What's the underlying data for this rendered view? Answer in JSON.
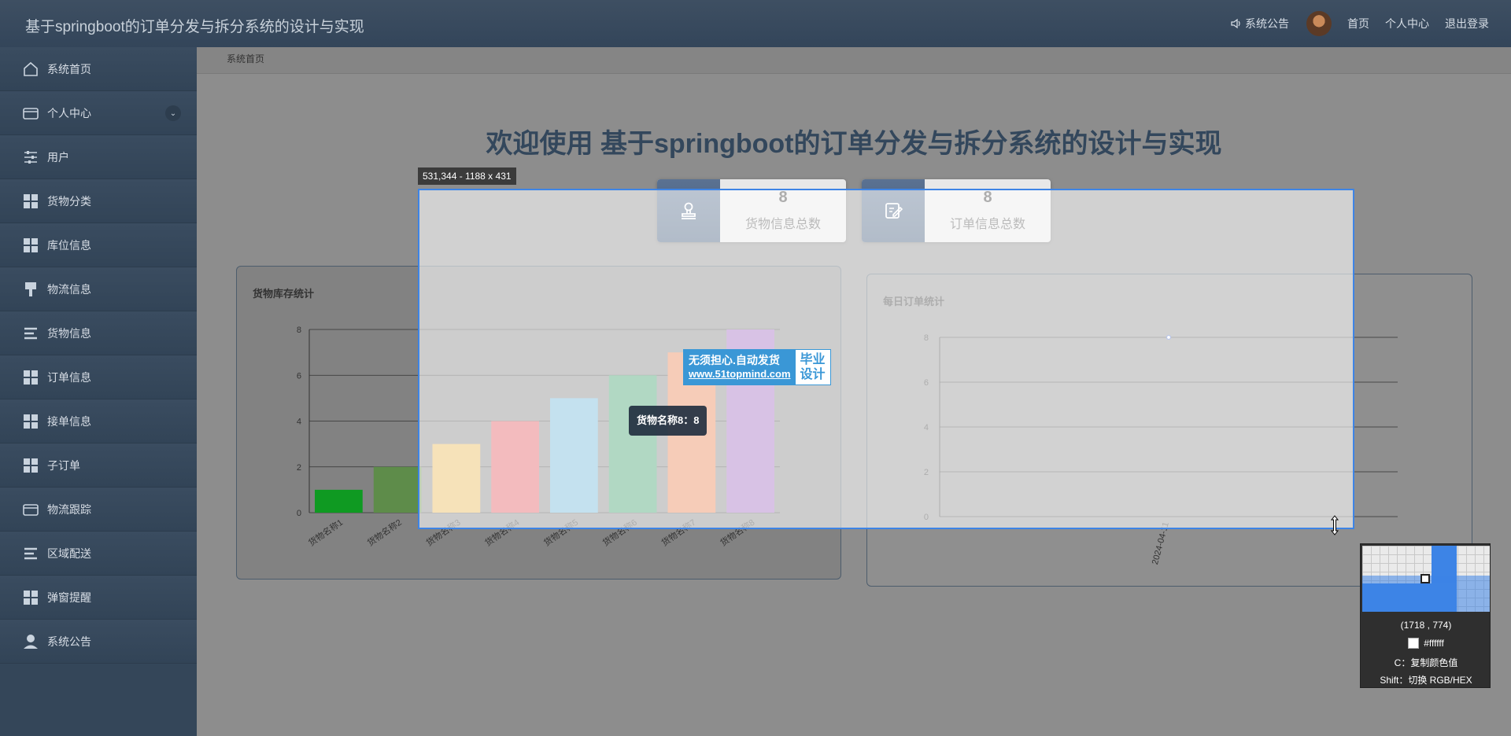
{
  "header": {
    "app_title": "基于springboot的订单分发与拆分系统的设计与实现",
    "notice": "系统公告",
    "home": "首页",
    "profile": "个人中心",
    "logout": "退出登录"
  },
  "sidebar": {
    "items": [
      {
        "label": "系统首页",
        "icon": "home-icon"
      },
      {
        "label": "个人中心",
        "icon": "wallet-icon"
      },
      {
        "label": "用户",
        "icon": "sliders-icon"
      },
      {
        "label": "货物分类",
        "icon": "grid-icon"
      },
      {
        "label": "库位信息",
        "icon": "grid-icon"
      },
      {
        "label": "物流信息",
        "icon": "brush-icon"
      },
      {
        "label": "货物信息",
        "icon": "list-icon"
      },
      {
        "label": "订单信息",
        "icon": "grid-icon"
      },
      {
        "label": "接单信息",
        "icon": "grid-icon"
      },
      {
        "label": "子订单",
        "icon": "grid-icon"
      },
      {
        "label": "物流跟踪",
        "icon": "wallet-icon"
      },
      {
        "label": "区域配送",
        "icon": "list-icon"
      },
      {
        "label": "弹窗提醒",
        "icon": "grid-icon"
      },
      {
        "label": "系统公告",
        "icon": "user-icon"
      }
    ]
  },
  "breadcrumb": "系统首页",
  "welcome": "欢迎使用 基于springboot的订单分发与拆分系统的设计与实现",
  "stats": [
    {
      "value": "8",
      "label": "货物信息总数",
      "icon": "stamp-icon"
    },
    {
      "value": "8",
      "label": "订单信息总数",
      "icon": "edit-icon"
    }
  ],
  "bar_panel_title": "货物库存统计",
  "line_panel_title": "每日订单统计",
  "tooltip": "货物名称8：8",
  "watermark": {
    "line1": "无须担心.自动发货",
    "line2": "www.51topmind.com",
    "right1": "毕业",
    "right2": "设计"
  },
  "screenshot_tool": {
    "size_label": "531,344 - 1188 x 431",
    "coords": "(1718 , 774)",
    "color": "#ffffff",
    "hint_copy": "C：复制颜色值",
    "hint_switch": "Shift：切换 RGB/HEX"
  },
  "colors": {
    "selection": "#3d84e6",
    "header": "#3a4b5e",
    "sidebar": "#344659"
  },
  "chart_data": [
    {
      "type": "bar",
      "title": "货物库存统计",
      "categories": [
        "货物名称1",
        "货物名称2",
        "货物名称3",
        "货物名称4",
        "货物名称5",
        "货物名称6",
        "货物名称7",
        "货物名称8"
      ],
      "values": [
        1,
        2,
        3,
        4,
        5,
        6,
        7,
        8
      ],
      "colors": [
        "#0f9a22",
        "#5e8c4a",
        "#e8b651",
        "#e0565d",
        "#6db5d6",
        "#3d9f6a",
        "#e8804e",
        "#9f68bd"
      ],
      "ylim": [
        0,
        8
      ],
      "yticks": [
        0,
        2,
        4,
        6,
        8
      ],
      "grid": true
    },
    {
      "type": "line",
      "title": "每日订单统计",
      "x": [
        "2024-04-11"
      ],
      "values": [
        8
      ],
      "ylim": [
        0,
        8
      ],
      "yticks": [
        0,
        2,
        4,
        6,
        8
      ],
      "grid": true
    }
  ]
}
